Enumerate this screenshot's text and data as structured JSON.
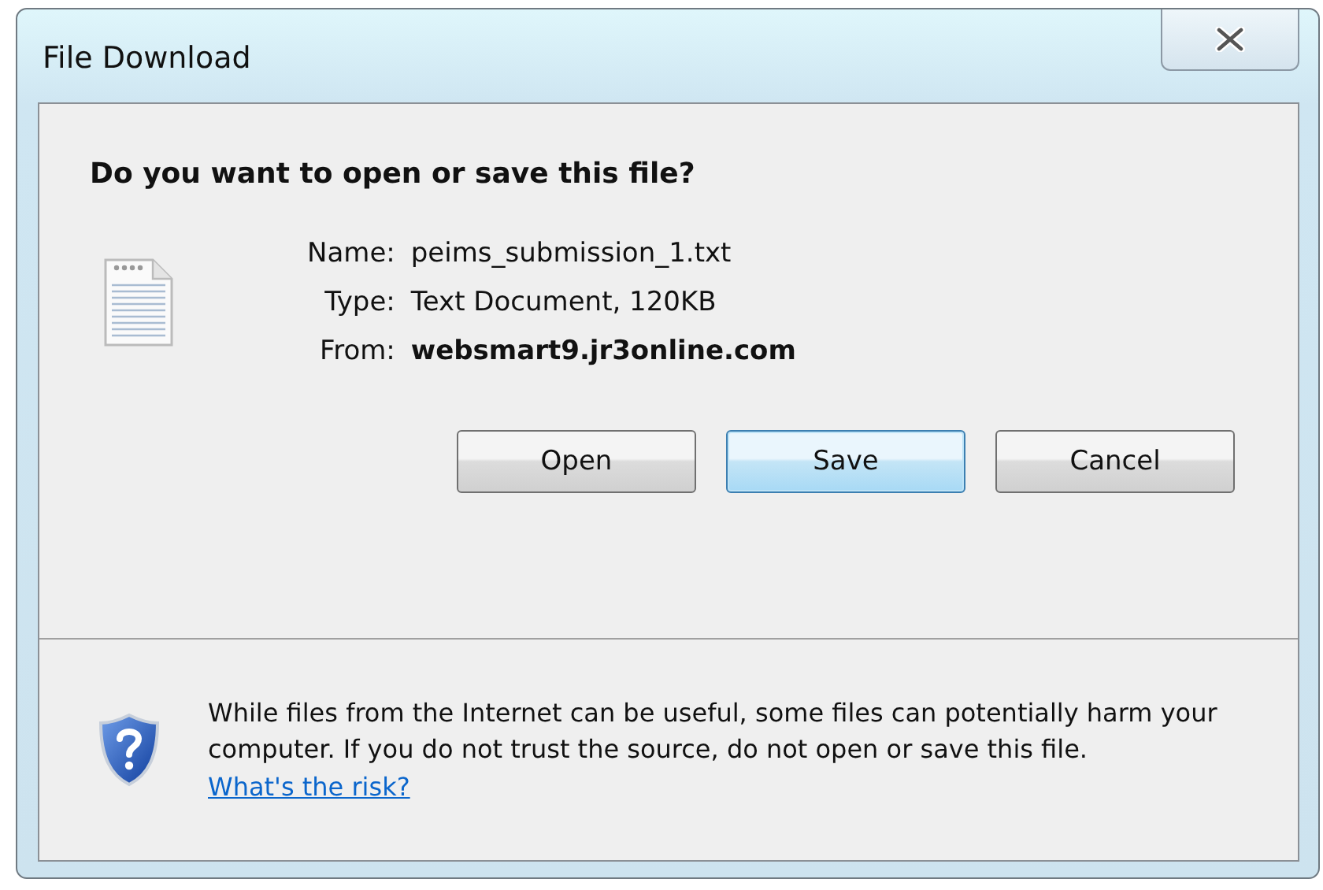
{
  "window": {
    "title": "File Download"
  },
  "heading": "Do you want to open or save this file?",
  "file_info": [
    {
      "label": "Name:",
      "value": "peims_submission_1.txt",
      "bold": false
    },
    {
      "label": "Type:",
      "value": "Text Document, 120KB",
      "bold": false
    },
    {
      "label": "From:",
      "value": "websmart9.jr3online.com",
      "bold": true
    }
  ],
  "buttons": [
    {
      "label": "Open",
      "selected": false
    },
    {
      "label": "Save",
      "selected": true
    },
    {
      "label": "Cancel",
      "selected": false
    }
  ],
  "warning": {
    "text": "While files from the Internet can be useful, some files can potentially harm your computer. If you do not trust the source, do not open or save this file.",
    "link": "What's the risk?"
  }
}
